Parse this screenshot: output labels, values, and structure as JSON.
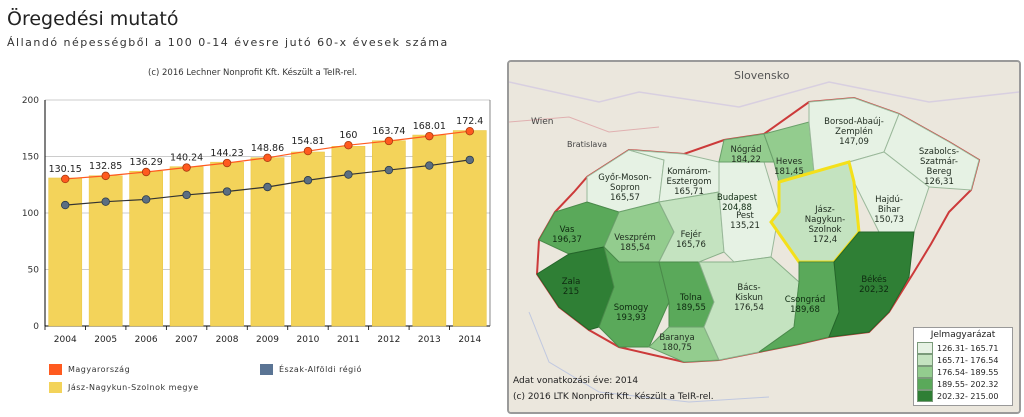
{
  "header": {
    "title": "Öregedési mutató",
    "subtitle": "Állandó népességből a 100 0-14 évesre jutó 60-x évesek száma",
    "credit": "(c) 2016 Lechner Nonprofit Kft. Készült a TeIR-rel."
  },
  "chart_data": {
    "type": "bar",
    "categories": [
      "2004",
      "2005",
      "2006",
      "2007",
      "2008",
      "2009",
      "2010",
      "2011",
      "2012",
      "2013",
      "2014"
    ],
    "ylim": [
      0,
      200
    ],
    "yticks": [
      0,
      50,
      100,
      150,
      200
    ],
    "series": [
      {
        "name": "Jász-Nagykun-Szolnok megye",
        "kind": "bar",
        "color": "#f3d35a",
        "values": [
          131,
          133,
          137,
          141,
          145,
          149,
          154,
          159,
          164,
          169,
          173
        ]
      },
      {
        "name": "Magyarország",
        "kind": "line",
        "color": "#ff5a1f",
        "values": [
          130.15,
          132.85,
          136.29,
          140.24,
          144.23,
          148.86,
          154.81,
          160,
          163.74,
          168.01,
          172.4
        ],
        "labels": [
          "130.15",
          "132.85",
          "136.29",
          "140.24",
          "144.23",
          "148.86",
          "154.81",
          "160",
          "163.74",
          "168.01",
          "172.4"
        ]
      },
      {
        "name": "Észak-Alföldi régió",
        "kind": "line",
        "color": "#4f6f8f",
        "values": [
          107,
          110,
          112,
          116,
          119,
          123,
          129,
          134,
          138,
          142,
          147
        ]
      }
    ]
  },
  "legend": {
    "magyarorszag": "Magyarország",
    "regio": "Észak-Alföldi régió",
    "megye": "Jász-Nagykun-Szolnok megye",
    "colors": {
      "magyarorszag": "#ff5a1f",
      "regio": "#5a7494",
      "megye": "#f3d35a"
    }
  },
  "map": {
    "country_label": "Slovensko",
    "city_labels": {
      "wien": "Wien",
      "bratislava": "Bratislava"
    },
    "counties": [
      {
        "id": "gyor",
        "name": "Győr-Moson-\nSopron",
        "value": "165,57"
      },
      {
        "id": "komarom",
        "name": "Komárom-\nEsztergom",
        "value": "165,71"
      },
      {
        "id": "vas",
        "name": "Vas",
        "value": "196,37"
      },
      {
        "id": "veszprem",
        "name": "Veszprém",
        "value": "185,54"
      },
      {
        "id": "fejer",
        "name": "Fejér",
        "value": "165,76"
      },
      {
        "id": "zala",
        "name": "Zala",
        "value": "215"
      },
      {
        "id": "somogy",
        "name": "Somogy",
        "value": "193,93"
      },
      {
        "id": "tolna",
        "name": "Tolna",
        "value": "189,55"
      },
      {
        "id": "baranya",
        "name": "Baranya",
        "value": "180,75"
      },
      {
        "id": "budapest",
        "name": "Budapest",
        "value": "204,88"
      },
      {
        "id": "pest",
        "name": "Pest",
        "value": "135,21"
      },
      {
        "id": "nograd",
        "name": "Nógrád",
        "value": "184,22"
      },
      {
        "id": "heves",
        "name": "Heves",
        "value": "181,45"
      },
      {
        "id": "borsod",
        "name": "Borsod-Abaúj-\nZemplén",
        "value": "147,09"
      },
      {
        "id": "szabolcs",
        "name": "Szabolcs-\nSzatmár-\nBereg",
        "value": "126,31"
      },
      {
        "id": "hajdu",
        "name": "Hajdú-\nBihar",
        "value": "150,73"
      },
      {
        "id": "jasz",
        "name": "Jász-\nNagykun-\nSzolnok",
        "value": "172,4"
      },
      {
        "id": "bacs",
        "name": "Bács-\nKiskun",
        "value": "176,54"
      },
      {
        "id": "csongrad",
        "name": "Csongrád",
        "value": "189,68"
      },
      {
        "id": "bekes",
        "name": "Békés",
        "value": "202,32"
      }
    ],
    "reference_year": "Adat vonatkozási éve: 2014",
    "credit": "(c) 2016 LTK Nonprofit Kft. Készült a TeIR-rel.",
    "legend_title": "Jelmagyarázat",
    "legend_items": [
      {
        "label": "126.31- 165.71",
        "color": "#e6f2e4"
      },
      {
        "label": "165.71- 176.54",
        "color": "#c4e3c0"
      },
      {
        "label": "176.54- 189.55",
        "color": "#93cc8e"
      },
      {
        "label": "189.55- 202.32",
        "color": "#5aa95a"
      },
      {
        "label": "202.32- 215.00",
        "color": "#2f7f35"
      }
    ]
  }
}
